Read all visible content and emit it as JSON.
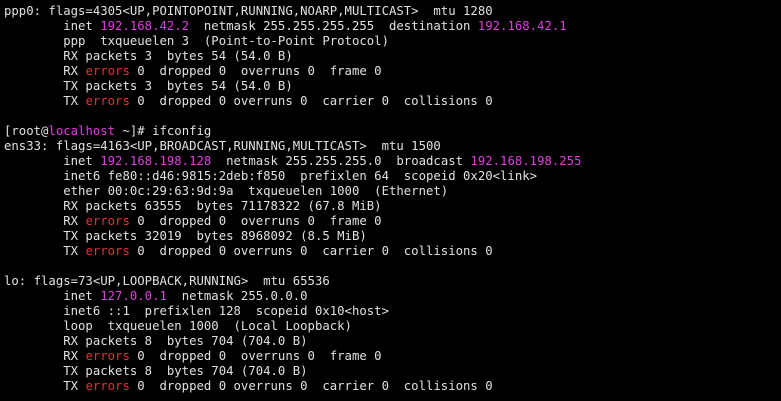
{
  "colors": {
    "background": "#000000",
    "text": "#e0e0e0",
    "ip_highlight": "#e03ce0",
    "error_highlight": "#e03434"
  },
  "lines": [
    [
      {
        "t": "ppp0: flags=4305<UP,POINTOPOINT,RUNNING,NOARP,MULTICAST>  mtu 1280"
      }
    ],
    [
      {
        "t": "        inet "
      },
      {
        "t": "192.168.42.2",
        "c": "magenta"
      },
      {
        "t": "  netmask 255.255.255.255  destination "
      },
      {
        "t": "192.168.42.1",
        "c": "magenta"
      }
    ],
    [
      {
        "t": "        ppp  txqueuelen 3  (Point-to-Point Protocol)"
      }
    ],
    [
      {
        "t": "        RX packets 3  bytes 54 (54.0 B)"
      }
    ],
    [
      {
        "t": "        RX "
      },
      {
        "t": "errors",
        "c": "red"
      },
      {
        "t": " 0  dropped 0  overruns 0  frame 0"
      }
    ],
    [
      {
        "t": "        TX packets 3  bytes 54 (54.0 B)"
      }
    ],
    [
      {
        "t": "        TX "
      },
      {
        "t": "errors",
        "c": "red"
      },
      {
        "t": " 0  dropped 0 overruns 0  carrier 0  collisions 0"
      }
    ],
    [
      {
        "t": ""
      }
    ],
    [
      {
        "t": "[root@"
      },
      {
        "t": "localhost",
        "c": "magenta"
      },
      {
        "t": " ~]# ifconfig"
      }
    ],
    [
      {
        "t": "ens33: flags=4163<UP,BROADCAST,RUNNING,MULTICAST>  mtu 1500"
      }
    ],
    [
      {
        "t": "        inet "
      },
      {
        "t": "192.168.198.128",
        "c": "magenta"
      },
      {
        "t": "  netmask 255.255.255.0  broadcast "
      },
      {
        "t": "192.168.198.255",
        "c": "magenta"
      }
    ],
    [
      {
        "t": "        inet6 fe80::d46:9815:2deb:f850  prefixlen 64  scopeid 0x20<link>"
      }
    ],
    [
      {
        "t": "        ether 00:0c:29:63:9d:9a  txqueuelen 1000  (Ethernet)"
      }
    ],
    [
      {
        "t": "        RX packets 63555  bytes 71178322 (67.8 MiB)"
      }
    ],
    [
      {
        "t": "        RX "
      },
      {
        "t": "errors",
        "c": "red"
      },
      {
        "t": " 0  dropped 0  overruns 0  frame 0"
      }
    ],
    [
      {
        "t": "        TX packets 32019  bytes 8968092 (8.5 MiB)"
      }
    ],
    [
      {
        "t": "        TX "
      },
      {
        "t": "errors",
        "c": "red"
      },
      {
        "t": " 0  dropped 0 overruns 0  carrier 0  collisions 0"
      }
    ],
    [
      {
        "t": ""
      }
    ],
    [
      {
        "t": "lo: flags=73<UP,LOOPBACK,RUNNING>  mtu 65536"
      }
    ],
    [
      {
        "t": "        inet "
      },
      {
        "t": "127.0.0.1",
        "c": "magenta"
      },
      {
        "t": "  netmask 255.0.0.0"
      }
    ],
    [
      {
        "t": "        inet6 ::1  prefixlen 128  scopeid 0x10<host>"
      }
    ],
    [
      {
        "t": "        loop  txqueuelen 1000  (Local Loopback)"
      }
    ],
    [
      {
        "t": "        RX packets 8  bytes 704 (704.0 B)"
      }
    ],
    [
      {
        "t": "        RX "
      },
      {
        "t": "errors",
        "c": "red"
      },
      {
        "t": " 0  dropped 0  overruns 0  frame 0"
      }
    ],
    [
      {
        "t": "        TX packets 8  bytes 704 (704.0 B)"
      }
    ],
    [
      {
        "t": "        TX "
      },
      {
        "t": "errors",
        "c": "red"
      },
      {
        "t": " 0  dropped 0 overruns 0  carrier 0  collisions 0"
      }
    ]
  ]
}
